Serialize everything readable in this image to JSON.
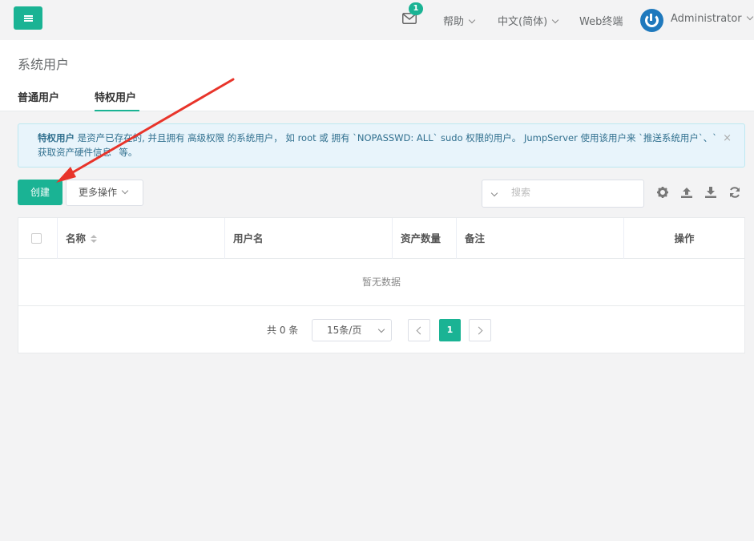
{
  "topbar": {
    "mail_badge": "1",
    "help_label": "帮助",
    "language_label": "中文(简体)",
    "web_terminal_label": "Web终端",
    "user_name": "Administrator"
  },
  "page": {
    "title": "系统用户",
    "tabs": [
      {
        "label": "普通用户",
        "active": false
      },
      {
        "label": "特权用户",
        "active": true
      }
    ]
  },
  "alert": {
    "highlight": "特权用户",
    "text": " 是资产已存在的, 并且拥有 高级权限 的系统用户， 如 root 或 拥有 `NOPASSWD: ALL` sudo 权限的用户。 JumpServer 使用该用户来 `推送系统用户`、`获取资产硬件信息` 等。",
    "close": "×"
  },
  "toolbar": {
    "create_label": "创建",
    "more_label": "更多操作",
    "search_placeholder": "搜索"
  },
  "table": {
    "columns": [
      "名称",
      "用户名",
      "资产数量",
      "备注",
      "操作"
    ],
    "empty_text": "暂无数据"
  },
  "pagination": {
    "total_text": "共 0 条",
    "page_size": "15条/页",
    "current_page": "1"
  },
  "colors": {
    "accent": "#1ab394",
    "annotation_arrow": "#e8342a"
  }
}
